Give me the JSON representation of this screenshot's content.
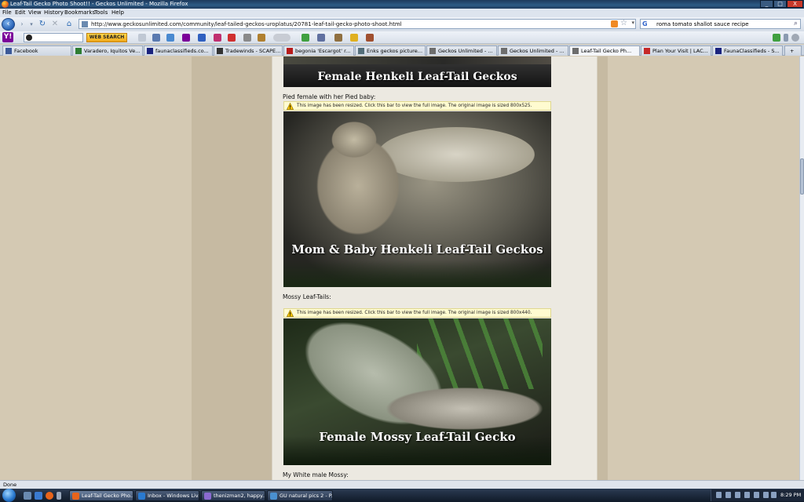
{
  "window": {
    "title": "Leaf-Tail Gecko Photo Shoot!! - Geckos Unlimited - Mozilla Firefox",
    "minimize": "_",
    "maximize": "□",
    "close": "X"
  },
  "menu": [
    "File",
    "Edit",
    "View",
    "History",
    "Bookmarks",
    "Tools",
    "Help"
  ],
  "navigation": {
    "url": "http://www.geckosunlimited.com/community/leaf-tailed-geckos-uroplatus/20781-leaf-tail-gecko-photo-shoot.html",
    "search_query": "roma tomato shallot sauce recipe",
    "back_icon": "back-arrow-icon"
  },
  "yahoo_toolbar": {
    "logo": "Y!",
    "search_button": "WEB SEARCH"
  },
  "tabs": [
    {
      "label": "Facebook",
      "color": "#3b5998"
    },
    {
      "label": "Varadero, Iquitos Ve...",
      "color": "#2e7d32"
    },
    {
      "label": "faunaclassifieds.co...",
      "color": "#1a237e"
    },
    {
      "label": "Tradewinds - SCAPE...",
      "color": "#333333"
    },
    {
      "label": "begonia 'Escargot' r...",
      "color": "#b71c1c"
    },
    {
      "label": "Enks geckos picture...",
      "color": "#546e7a"
    },
    {
      "label": "Geckos Unlimited - ...",
      "color": "#6d6d6d"
    },
    {
      "label": "Geckos Unlimited - ...",
      "color": "#6d6d6d"
    },
    {
      "label": "Leaf-Tail Gecko Ph...",
      "color": "#6d6d6d",
      "active": true
    },
    {
      "label": "Plan Your Visit | LAC...",
      "color": "#c62828"
    },
    {
      "label": "FaunaClassifieds - S...",
      "color": "#1a237e"
    }
  ],
  "post": {
    "top_photo_overlay": "Female Henkeli Leaf-Tail Geckos",
    "caption1": "Pied female with her Pied baby:",
    "resize_notice1": "This image has been resized. Click this bar to view the full image. The original image is sized 800x525.",
    "photo1_overlay": "Mom & Baby Henkeli Leaf-Tail Geckos",
    "caption2": "Mossy Leaf-Tails:",
    "resize_notice2": "This image has been resized. Click this bar to view the full image. The original image is sized 800x440.",
    "photo2_overlay": "Female Mossy Leaf-Tail Gecko",
    "caption3": "My White male Mossy:"
  },
  "status": "Done",
  "taskbar": {
    "items": [
      {
        "label": "Leaf-Tail Gecko Pho...",
        "color": "#e8641b",
        "active": true
      },
      {
        "label": "Inbox - Windows Liv...",
        "color": "#2a7ad0"
      },
      {
        "label": "thenizman2, happy...",
        "color": "#8a6ad0"
      },
      {
        "label": "GU natural pics 2 - P...",
        "color": "#4a90d0"
      }
    ],
    "clock": "8:29 PM"
  }
}
